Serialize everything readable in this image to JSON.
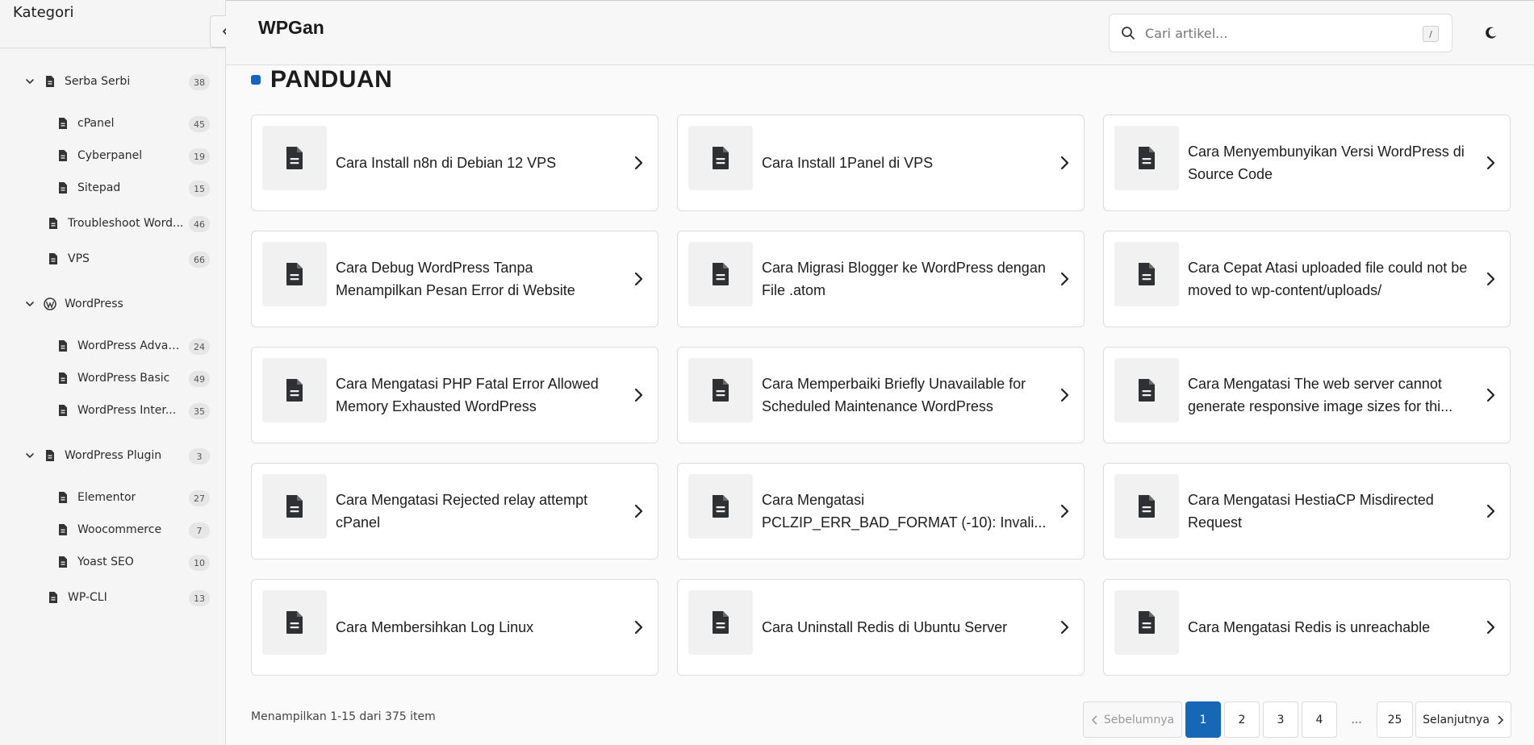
{
  "sidebar": {
    "title": "Kategori",
    "items": [
      {
        "label": "Serba Serbi",
        "count": "38",
        "icon": "document-icon",
        "expanded": true
      },
      {
        "label": "cPanel",
        "count": "45",
        "icon": "document-icon"
      },
      {
        "label": "Cyberpanel",
        "count": "19",
        "icon": "document-icon"
      },
      {
        "label": "Sitepad",
        "count": "15",
        "icon": "document-icon"
      },
      {
        "label": "Troubleshoot Word...",
        "count": "46",
        "icon": "document-icon"
      },
      {
        "label": "VPS",
        "count": "66",
        "icon": "document-icon"
      },
      {
        "label": "WordPress",
        "count": "",
        "icon": "wordpress-icon",
        "expanded": true
      },
      {
        "label": "WordPress Advan...",
        "count": "24",
        "icon": "document-icon"
      },
      {
        "label": "WordPress Basic",
        "count": "49",
        "icon": "document-icon"
      },
      {
        "label": "WordPress Inter...",
        "count": "35",
        "icon": "document-icon"
      },
      {
        "label": "WordPress Plugin",
        "count": "3",
        "icon": "document-icon",
        "expanded": true
      },
      {
        "label": "Elementor",
        "count": "27",
        "icon": "document-icon"
      },
      {
        "label": "Woocommerce",
        "count": "7",
        "icon": "document-icon"
      },
      {
        "label": "Yoast SEO",
        "count": "10",
        "icon": "document-icon"
      },
      {
        "label": "WP-CLI",
        "count": "13",
        "icon": "document-icon"
      }
    ]
  },
  "header": {
    "site_title": "WPGan",
    "search_placeholder": "Cari artikel...",
    "search_shortcut": "/"
  },
  "section": {
    "title": "PANDUAN",
    "accent": "#1565c0"
  },
  "articles": [
    {
      "title": "Cara Install n8n di Debian 12 VPS"
    },
    {
      "title": "Cara Install 1Panel di VPS"
    },
    {
      "title": "Cara Menyembunyikan Versi WordPress di Source Code"
    },
    {
      "title": "Cara Debug WordPress Tanpa Menampilkan Pesan Error di Website"
    },
    {
      "title": "Cara Migrasi Blogger ke WordPress dengan File .atom"
    },
    {
      "title": "Cara Cepat Atasi uploaded file could not be moved to wp-content/uploads/"
    },
    {
      "title": "Cara Mengatasi PHP Fatal Error Allowed Memory Exhausted WordPress"
    },
    {
      "title": "Cara Memperbaiki Briefly Unavailable for Scheduled Maintenance WordPress"
    },
    {
      "title": "Cara Mengatasi The web server cannot generate responsive image sizes for thi..."
    },
    {
      "title": "Cara Mengatasi Rejected relay attempt cPanel"
    },
    {
      "title": "Cara Mengatasi PCLZIP_ERR_BAD_FORMAT (-10): Invali..."
    },
    {
      "title": "Cara Mengatasi HestiaCP Misdirected Request"
    },
    {
      "title": "Cara Membersihkan Log Linux"
    },
    {
      "title": "Cara Uninstall Redis di Ubuntu Server"
    },
    {
      "title": "Cara Mengatasi Redis is unreachable"
    }
  ],
  "pagination": {
    "summary": "Menampilkan 1-15 dari 375 item",
    "prev_label": "Sebelumnya",
    "next_label": "Selanjutnya",
    "pages": [
      "1",
      "2",
      "3",
      "4"
    ],
    "ellipsis": "...",
    "last_page": "25",
    "current": "1"
  }
}
